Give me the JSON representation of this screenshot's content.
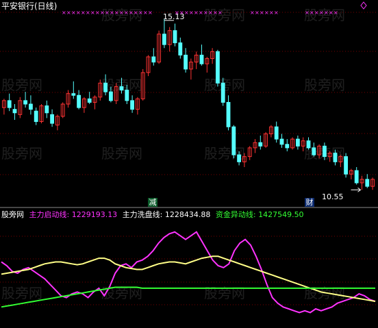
{
  "title": "平安银行(日线)",
  "watermark": "股旁网",
  "price_high_label": "15.13",
  "price_low_label": "10.55",
  "badges": {
    "reduce": "减",
    "wealth": "财"
  },
  "legend": {
    "source": "股旁网",
    "items": [
      {
        "label": "主力启动线: 1229193.13",
        "color": "#ff33ff"
      },
      {
        "label": "主力洗盘线: 1228434.88",
        "color": "#ffffff"
      },
      {
        "label": "资金异动线: 1427549.50",
        "color": "#33ff33"
      }
    ]
  },
  "colors": {
    "up": "#ff3333",
    "down": "#55ffff",
    "grid": "#7a0000",
    "magenta": "#ff33ff",
    "yellow": "#ffff88",
    "green": "#33ff33"
  },
  "chart_data": [
    {
      "type": "candlestick",
      "title": "平安银行(日线)",
      "ylim": [
        10.0,
        15.4
      ],
      "annotations": [
        "15.13",
        "10.55"
      ],
      "ohlc": [
        [
          12.6,
          12.85,
          12.4,
          12.8
        ],
        [
          12.8,
          13.0,
          12.5,
          12.6
        ],
        [
          12.55,
          12.7,
          12.25,
          12.45
        ],
        [
          12.4,
          12.9,
          12.3,
          12.8
        ],
        [
          12.8,
          13.05,
          12.6,
          12.7
        ],
        [
          12.7,
          12.95,
          12.4,
          12.55
        ],
        [
          12.5,
          12.6,
          12.1,
          12.2
        ],
        [
          12.2,
          12.7,
          12.15,
          12.65
        ],
        [
          12.65,
          12.8,
          12.3,
          12.45
        ],
        [
          12.4,
          12.55,
          12.05,
          12.15
        ],
        [
          12.1,
          12.4,
          11.95,
          12.35
        ],
        [
          12.35,
          12.75,
          12.3,
          12.7
        ],
        [
          12.7,
          13.1,
          12.6,
          13.0
        ],
        [
          13.0,
          13.35,
          12.85,
          12.95
        ],
        [
          12.95,
          13.1,
          12.55,
          12.6
        ],
        [
          12.6,
          12.9,
          12.45,
          12.85
        ],
        [
          12.85,
          13.05,
          12.7,
          12.75
        ],
        [
          12.75,
          12.95,
          12.55,
          12.9
        ],
        [
          12.9,
          13.4,
          12.8,
          13.3
        ],
        [
          13.3,
          13.55,
          12.95,
          13.05
        ],
        [
          13.05,
          13.2,
          12.75,
          12.8
        ],
        [
          12.8,
          13.3,
          12.7,
          13.2
        ],
        [
          13.2,
          13.45,
          13.0,
          13.1
        ],
        [
          13.1,
          13.25,
          12.7,
          12.8
        ],
        [
          12.8,
          12.95,
          12.45,
          12.55
        ],
        [
          12.55,
          12.9,
          12.4,
          12.85
        ],
        [
          12.85,
          13.7,
          12.8,
          13.6
        ],
        [
          13.6,
          14.1,
          13.5,
          14.05
        ],
        [
          14.05,
          14.3,
          13.8,
          13.9
        ],
        [
          13.9,
          14.8,
          13.85,
          14.7
        ],
        [
          14.7,
          15.13,
          14.3,
          14.4
        ],
        [
          14.4,
          14.9,
          14.2,
          14.8
        ],
        [
          14.8,
          15.0,
          14.35,
          14.45
        ],
        [
          14.45,
          14.6,
          14.0,
          14.1
        ],
        [
          14.1,
          14.3,
          13.6,
          13.7
        ],
        [
          13.7,
          14.0,
          13.4,
          13.9
        ],
        [
          13.9,
          14.2,
          13.7,
          14.1
        ],
        [
          14.1,
          14.4,
          13.8,
          13.85
        ],
        [
          13.85,
          14.05,
          13.6,
          14.0
        ],
        [
          14.0,
          14.3,
          13.85,
          14.2
        ],
        [
          14.2,
          14.25,
          13.2,
          13.3
        ],
        [
          13.3,
          13.45,
          12.65,
          12.75
        ],
        [
          12.75,
          12.95,
          11.95,
          12.05
        ],
        [
          12.05,
          12.1,
          11.15,
          11.25
        ],
        [
          11.25,
          11.35,
          10.95,
          11.05
        ],
        [
          11.05,
          11.3,
          10.9,
          11.2
        ],
        [
          11.2,
          11.5,
          11.1,
          11.45
        ],
        [
          11.45,
          11.7,
          11.3,
          11.6
        ],
        [
          11.6,
          11.8,
          11.4,
          11.5
        ],
        [
          11.5,
          11.9,
          11.45,
          11.85
        ],
        [
          11.85,
          12.1,
          11.75,
          12.05
        ],
        [
          12.05,
          12.2,
          11.6,
          11.7
        ],
        [
          11.7,
          11.85,
          11.45,
          11.55
        ],
        [
          11.55,
          11.7,
          11.35,
          11.45
        ],
        [
          11.45,
          11.75,
          11.4,
          11.7
        ],
        [
          11.7,
          11.8,
          11.4,
          11.5
        ],
        [
          11.5,
          11.75,
          11.35,
          11.65
        ],
        [
          11.65,
          11.75,
          11.4,
          11.45
        ],
        [
          11.45,
          11.6,
          11.2,
          11.25
        ],
        [
          11.25,
          11.55,
          11.15,
          11.5
        ],
        [
          11.5,
          11.6,
          11.1,
          11.2
        ],
        [
          11.2,
          11.35,
          11.05,
          11.3
        ],
        [
          11.3,
          11.4,
          10.95,
          11.05
        ],
        [
          11.05,
          11.25,
          10.9,
          11.2
        ],
        [
          11.2,
          11.3,
          10.6,
          10.7
        ],
        [
          10.7,
          10.85,
          10.55,
          10.8
        ],
        [
          10.8,
          10.9,
          10.4,
          10.45
        ],
        [
          10.45,
          10.65,
          10.25,
          10.55
        ],
        [
          10.55,
          10.7,
          10.3,
          10.35
        ],
        [
          10.35,
          10.6,
          10.25,
          10.55
        ]
      ]
    },
    {
      "type": "line",
      "ylim": [
        0,
        100
      ],
      "series": [
        {
          "name": "主力启动线",
          "color": "#ff33ff",
          "values": [
            58,
            54,
            48,
            46,
            50,
            52,
            48,
            44,
            40,
            34,
            28,
            22,
            20,
            24,
            26,
            24,
            20,
            26,
            30,
            22,
            32,
            46,
            54,
            56,
            52,
            58,
            60,
            64,
            70,
            78,
            84,
            88,
            90,
            86,
            82,
            86,
            90,
            80,
            70,
            60,
            54,
            52,
            56,
            70,
            78,
            82,
            76,
            64,
            50,
            34,
            20,
            14,
            10,
            8,
            6,
            4,
            6,
            4,
            8,
            6,
            8,
            10,
            14,
            16,
            18,
            20,
            24,
            22,
            18,
            16
          ]
        },
        {
          "name": "主力洗盘线",
          "color": "#ffff88",
          "values": [
            45,
            46,
            47,
            48,
            49,
            50,
            52,
            54,
            56,
            57,
            58,
            58,
            57,
            56,
            55,
            56,
            58,
            60,
            62,
            62,
            60,
            56,
            54,
            52,
            51,
            50,
            50,
            52,
            54,
            56,
            57,
            58,
            58,
            57,
            56,
            58,
            60,
            62,
            63,
            64,
            64,
            62,
            60,
            58,
            56,
            54,
            52,
            50,
            48,
            46,
            44,
            42,
            40,
            38,
            36,
            34,
            32,
            30,
            28,
            26,
            25,
            24,
            23,
            22,
            21,
            20,
            19,
            18,
            17,
            16
          ]
        },
        {
          "name": "资金异动线",
          "color": "#33ff33",
          "values": [
            10,
            11,
            12,
            13,
            14,
            15,
            16,
            17,
            18,
            19,
            20,
            21,
            22,
            23,
            24,
            25,
            26,
            27,
            28,
            29,
            30,
            31,
            31,
            31,
            31,
            31,
            30,
            30,
            30,
            30,
            30,
            30,
            30,
            30,
            30,
            30,
            30,
            30,
            30,
            30,
            30,
            30,
            30,
            30,
            30,
            30,
            30,
            30,
            30,
            30,
            30,
            30,
            30,
            30,
            30,
            30,
            30,
            30,
            30,
            30,
            30,
            30,
            30,
            30,
            30,
            30,
            30,
            30,
            30,
            30
          ]
        }
      ]
    }
  ]
}
